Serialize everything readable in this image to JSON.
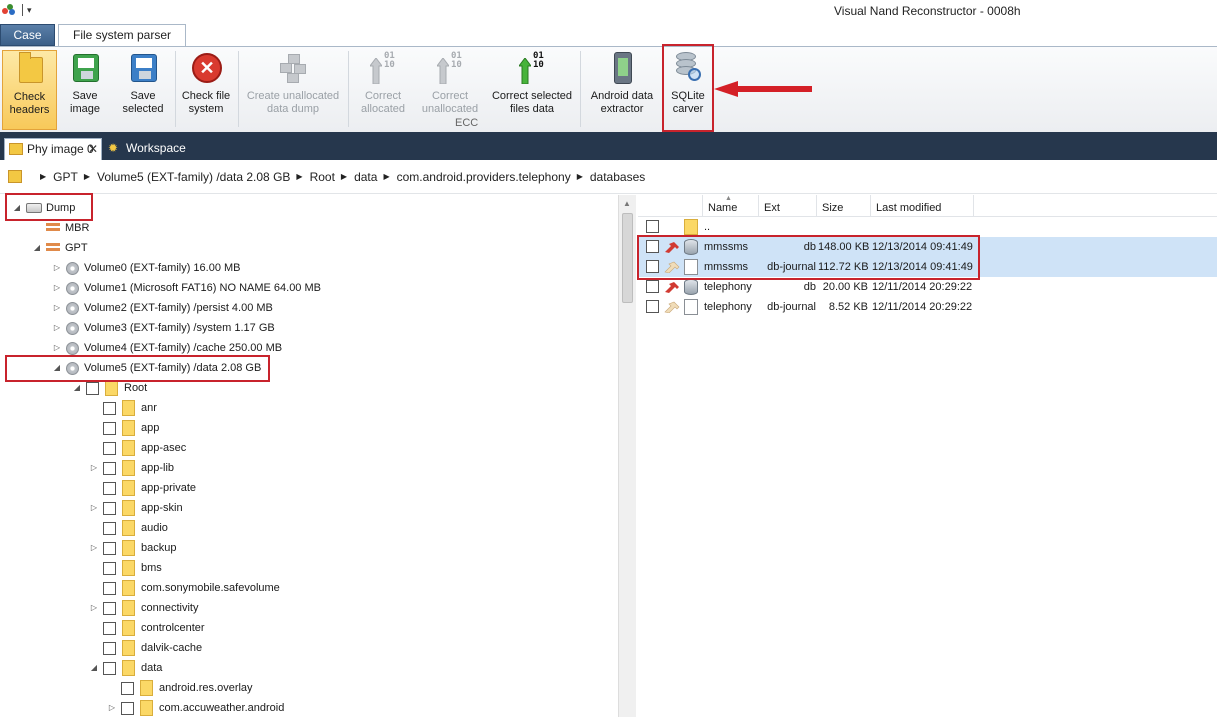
{
  "window": {
    "title": "Visual Nand Reconstructor - 0008h"
  },
  "ribbon_tabs": [
    {
      "label": "Case",
      "active": false
    },
    {
      "label": "File system parser",
      "active": true
    }
  ],
  "ribbon": {
    "buttons": {
      "check_headers": {
        "line1": "Check",
        "line2": "headers",
        "state": "active",
        "icon": "yellow-folder-flag-icon"
      },
      "save_image": {
        "line1": "Save",
        "line2": "image",
        "state": "enabled",
        "icon": "green-floppy-disk-icon"
      },
      "save_selected": {
        "line1": "Save",
        "line2": "selected",
        "state": "enabled",
        "icon": "blue-floppy-disk-icon"
      },
      "check_fs": {
        "line1": "Check file",
        "line2": "system",
        "state": "enabled",
        "icon": "red-error-icon"
      },
      "create_unalloc": {
        "line1": "Create unallocated",
        "line2": "data dump",
        "state": "disabled",
        "icon": "gray-blocks-icon"
      },
      "correct_alloc": {
        "line1": "Correct",
        "line2": "allocated",
        "state": "disabled",
        "icon": "gray-binary-arrow-icon"
      },
      "correct_unalloc": {
        "line1": "Correct",
        "line2": "unallocated",
        "state": "disabled",
        "icon": "gray-binary-arrow-icon"
      },
      "correct_selected": {
        "line1": "Correct selected",
        "line2": "files data",
        "state": "enabled",
        "icon": "green-binary-arrow-icon"
      },
      "android_extractor": {
        "line1": "Android data",
        "line2": "extractor",
        "state": "enabled",
        "icon": "android-phone-icon"
      },
      "sqlite_carver": {
        "line1": "SQLite",
        "line2": "carver",
        "state": "enabled",
        "icon": "sqlite-database-magnifier-icon"
      }
    },
    "groups": {
      "ecc": "ECC"
    },
    "binary_digits": {
      "row1": "01",
      "row2": "10"
    }
  },
  "doc_tabs": [
    {
      "label": "Phy image 0",
      "icon": "disk-image-icon",
      "active": true,
      "close": "✕"
    },
    {
      "label": "Workspace",
      "icon": "gear-icon",
      "active": false
    }
  ],
  "breadcrumb": [
    "GPT",
    "Volume5 (EXT-family) /data  2.08 GB",
    "Root",
    "data",
    "com.android.providers.telephony",
    "databases"
  ],
  "tree": {
    "dump": "Dump",
    "mbr": "MBR",
    "gpt": "GPT",
    "volumes": [
      "Volume0 (EXT-family) 16.00 MB",
      "Volume1 (Microsoft FAT16) NO NAME  64.00 MB",
      "Volume2 (EXT-family) /persist  4.00 MB",
      "Volume3 (EXT-family) /system  1.17 GB",
      "Volume4 (EXT-family) /cache  250.00 MB",
      "Volume5 (EXT-family) /data  2.08 GB"
    ],
    "root": "Root",
    "root_children": [
      "anr",
      "app",
      "app-asec",
      "app-lib",
      "app-private",
      "app-skin",
      "audio",
      "backup",
      "bms",
      "com.sonymobile.safevolume",
      "connectivity",
      "controlcenter",
      "dalvik-cache",
      "data"
    ],
    "data_children": [
      "android.res.overlay",
      "com.accuweather.android"
    ]
  },
  "file_list": {
    "columns": {
      "name": "Name",
      "ext": "Ext",
      "size": "Size",
      "modified": "Last modified"
    },
    "parent": "..",
    "rows": [
      {
        "name": "mmssms",
        "ext": "db",
        "size": "148.00 KB",
        "modified": "12/13/2014 09:41:49",
        "icon": "database-icon",
        "pin": "red-pin-icon",
        "selected": true
      },
      {
        "name": "mmssms",
        "ext": "db-journal",
        "size": "112.72 KB",
        "modified": "12/13/2014 09:41:49",
        "icon": "document-icon",
        "pin": "pale-pin-icon",
        "selected": true
      },
      {
        "name": "telephony",
        "ext": "db",
        "size": "20.00 KB",
        "modified": "12/11/2014 20:29:22",
        "icon": "database-icon",
        "pin": "red-pin-icon",
        "selected": false
      },
      {
        "name": "telephony",
        "ext": "db-journal",
        "size": "8.52 KB",
        "modified": "12/11/2014 20:29:22",
        "icon": "document-icon",
        "pin": "pale-pin-icon",
        "selected": false
      }
    ]
  },
  "colors": {
    "highlight_box": "#c8232c",
    "doc_tab_bar": "#26374d",
    "selection": "#cfe3f7",
    "folder": "#fbd866"
  }
}
